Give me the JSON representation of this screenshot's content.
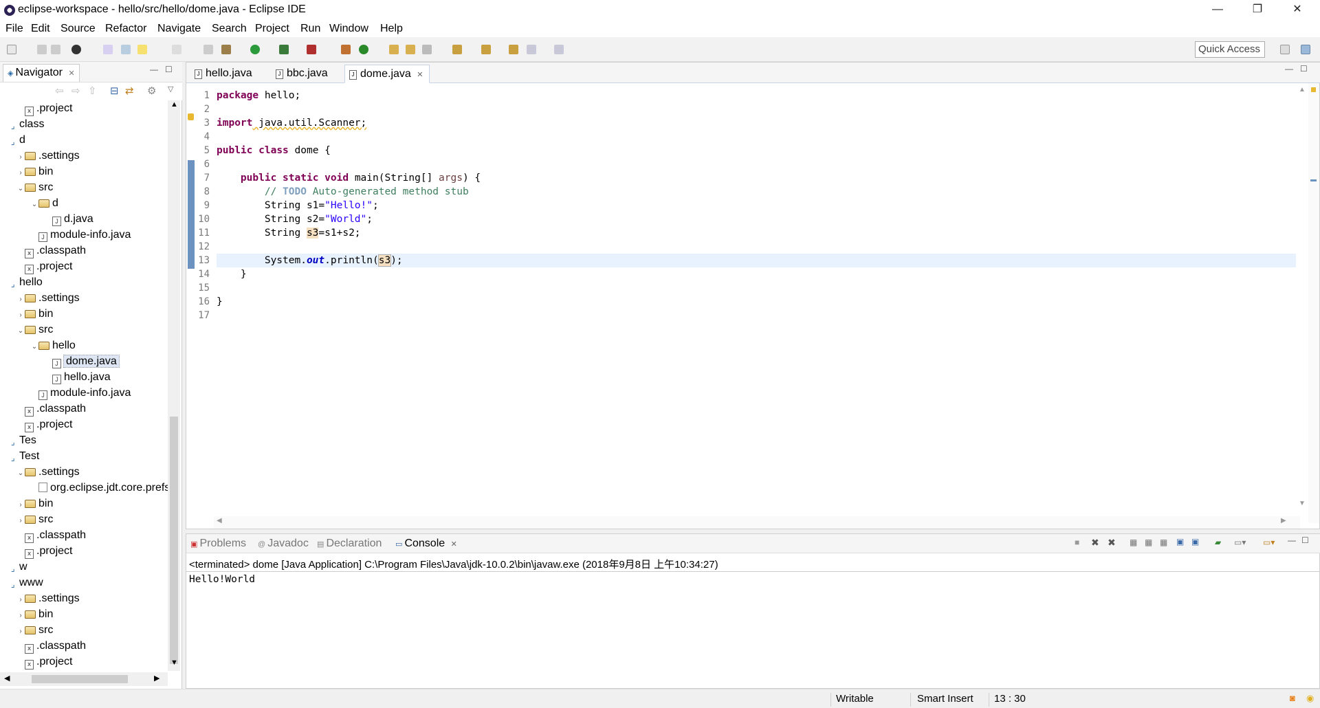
{
  "window": {
    "title": "eclipse-workspace - hello/src/hello/dome.java - Eclipse IDE",
    "controls": {
      "minimize": "—",
      "restore": "❐",
      "close": "✕"
    }
  },
  "menu": [
    "File",
    "Edit",
    "Source",
    "Refactor",
    "Navigate",
    "Search",
    "Project",
    "Run",
    "Window",
    "Help"
  ],
  "toolbar": {
    "quick_access": "Quick Access"
  },
  "navigator": {
    "tab_label": "Navigator",
    "tree": [
      {
        "label": ".project",
        "icon": "x"
      },
      {
        "label": "class",
        "icon": "project"
      },
      {
        "label": "d",
        "icon": "project"
      },
      {
        "label": ".settings",
        "icon": "folder"
      },
      {
        "label": "bin",
        "icon": "folder"
      },
      {
        "label": "src",
        "icon": "folder"
      },
      {
        "label": "d",
        "icon": "folder"
      },
      {
        "label": "d.java",
        "icon": "java"
      },
      {
        "label": "module-info.java",
        "icon": "java"
      },
      {
        "label": ".classpath",
        "icon": "x"
      },
      {
        "label": ".project",
        "icon": "x"
      },
      {
        "label": "hello",
        "icon": "project"
      },
      {
        "label": ".settings",
        "icon": "folder"
      },
      {
        "label": "bin",
        "icon": "folder"
      },
      {
        "label": "src",
        "icon": "folder"
      },
      {
        "label": "hello",
        "icon": "folder"
      },
      {
        "label": "dome.java",
        "icon": "java"
      },
      {
        "label": "hello.java",
        "icon": "java"
      },
      {
        "label": "module-info.java",
        "icon": "java"
      },
      {
        "label": ".classpath",
        "icon": "x"
      },
      {
        "label": ".project",
        "icon": "x"
      },
      {
        "label": "Tes",
        "icon": "project"
      },
      {
        "label": "Test",
        "icon": "project"
      },
      {
        "label": ".settings",
        "icon": "folder"
      },
      {
        "label": "org.eclipse.jdt.core.prefs",
        "icon": "file"
      },
      {
        "label": "bin",
        "icon": "folder"
      },
      {
        "label": "src",
        "icon": "folder"
      },
      {
        "label": ".classpath",
        "icon": "x"
      },
      {
        "label": ".project",
        "icon": "x"
      },
      {
        "label": "w",
        "icon": "project"
      },
      {
        "label": "www",
        "icon": "project"
      },
      {
        "label": ".settings",
        "icon": "folder"
      },
      {
        "label": "bin",
        "icon": "folder"
      },
      {
        "label": "src",
        "icon": "folder"
      },
      {
        "label": ".classpath",
        "icon": "x"
      },
      {
        "label": ".project",
        "icon": "x"
      }
    ]
  },
  "editor": {
    "tabs": [
      "hello.java",
      "bbc.java",
      "dome.java"
    ],
    "active_tab": "dome.java",
    "line_numbers": [
      "1",
      "2",
      "3",
      "4",
      "5",
      "6",
      "7",
      "8",
      "9",
      "10",
      "11",
      "12",
      "13",
      "14",
      "15",
      "16",
      "17"
    ],
    "code": {
      "l1_kw": "package",
      "l1_rest": " hello;",
      "l3_kw": "import",
      "l3_rest": " java.util.Scanner;",
      "l5_kw1": "public",
      "l5_kw2": "class",
      "l5_rest": " dome {",
      "l7_kw1": "public",
      "l7_kw2": "static",
      "l7_kw3": "void",
      "l7_mid": " main(String[] ",
      "l7_param": "args",
      "l7_end": ") {",
      "l8_c1": "// ",
      "l8_todo": "TODO",
      "l8_c2": " Auto-generated method stub",
      "l9_a": "String s1=",
      "l9_str": "\"Hello!\"",
      "l9_b": ";",
      "l10_a": "String s2=",
      "l10_str": "\"World\"",
      "l10_b": ";",
      "l11_a": "String ",
      "l11_occ": "s3",
      "l11_b": "=s1+s2;",
      "l13_a": "System.",
      "l13_field": "out",
      "l13_b": ".println(",
      "l13_occ": "s3",
      "l13_c": ");",
      "l14": "    }",
      "l16": "}"
    }
  },
  "console": {
    "tabs": [
      "Problems",
      "Javadoc",
      "Declaration",
      "Console"
    ],
    "description": "<terminated> dome [Java Application] C:\\Program Files\\Java\\jdk-10.0.2\\bin\\javaw.exe (2018年9月8日 上午10:34:27)",
    "output": "Hello!World"
  },
  "status": {
    "writable": "Writable",
    "insert_mode": "Smart Insert",
    "position": "13 : 30"
  }
}
